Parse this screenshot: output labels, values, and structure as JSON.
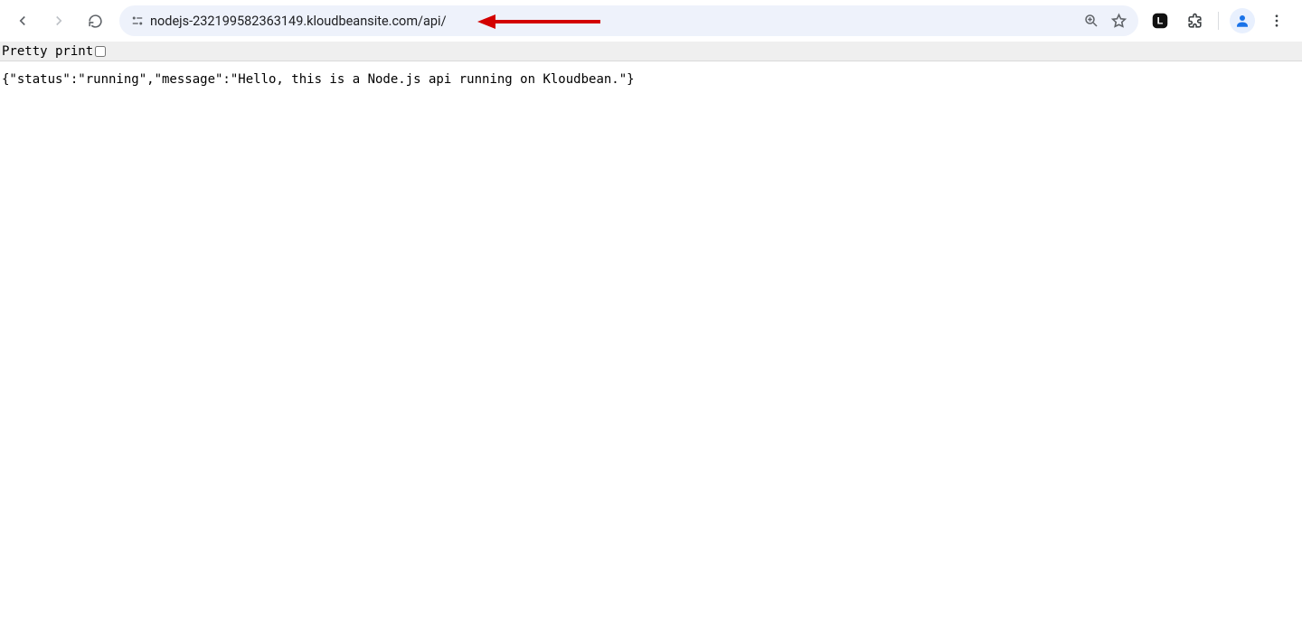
{
  "chrome": {
    "url": "nodejs-232199582363149.kloudbeansite.com/api/"
  },
  "pretty_print": {
    "label": "Pretty print",
    "checked": false
  },
  "response_text": "{\"status\":\"running\",\"message\":\"Hello, this is a Node.js api running on Kloudbean.\"}"
}
